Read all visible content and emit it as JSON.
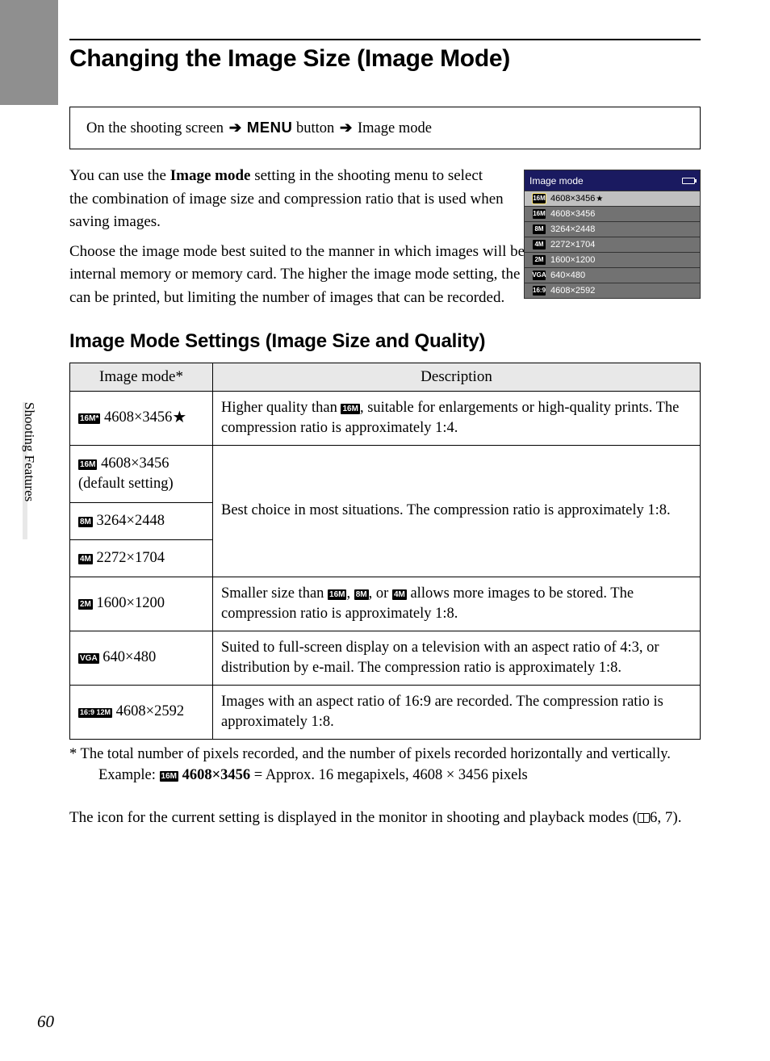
{
  "title": "Changing the Image Size (Image Mode)",
  "breadcrumb": {
    "pre": "On the shooting screen",
    "menu": "MENU",
    "mid": "button",
    "post": "Image mode"
  },
  "intro": {
    "p1_a": "You can use the ",
    "p1_bold": "Image mode",
    "p1_b": " setting in the shooting menu to select the combination of image size and compression ratio that is used when saving images.",
    "p2": "Choose the image mode best suited to the manner in which images will be used and the capacity of the internal memory or memory card. The higher the image mode setting, the larger the size at which it can be printed, but limiting the number of images that can be recorded."
  },
  "screenshot": {
    "title": "Image mode",
    "rows": [
      {
        "icon": "16M*",
        "label": "4608×3456",
        "star": true,
        "selected": true
      },
      {
        "icon": "16M",
        "label": "4608×3456"
      },
      {
        "icon": "8M",
        "label": "3264×2448"
      },
      {
        "icon": "4M",
        "label": "2272×1704"
      },
      {
        "icon": "2M",
        "label": "1600×1200"
      },
      {
        "icon": "VGA",
        "label": "640×480"
      },
      {
        "icon": "16:9",
        "label": "4608×2592"
      }
    ]
  },
  "subheading": "Image Mode Settings (Image Size and Quality)",
  "table": {
    "head_mode": "Image mode*",
    "head_desc": "Description",
    "r1_mode_icon": "16M*",
    "r1_mode_txt": "4608×3456",
    "r1_star": "★",
    "r1_desc_a": "Higher quality than ",
    "r1_desc_ic": "16M",
    "r1_desc_b": ", suitable for enlargements or high-quality prints. The compression ratio is approximately 1:4.",
    "r2_mode_icon": "16M",
    "r2_mode_txt": "4608×3456",
    "r2_sub": "(default setting)",
    "r3_mode_icon": "8M",
    "r3_mode_txt": "3264×2448",
    "r4_mode_icon": "4M",
    "r4_mode_txt": "2272×1704",
    "r234_desc": "Best choice in most situations. The compression ratio is approximately 1:8.",
    "r5_mode_icon": "2M",
    "r5_mode_txt": "1600×1200",
    "r5_desc_a": "Smaller size than ",
    "r5_ic1": "16M",
    "r5_sep1": ", ",
    "r5_ic2": "8M",
    "r5_sep2": ", or ",
    "r5_ic3": "4M",
    "r5_desc_b": " allows more images to be stored. The compression ratio is approximately 1:8.",
    "r6_mode_icon": "VGA",
    "r6_mode_txt": "640×480",
    "r6_desc": "Suited to full-screen display on a television with an aspect ratio of 4:3, or distribution by e-mail. The compression ratio is approximately 1:8.",
    "r7_mode_icon": "16:9 12M",
    "r7_mode_txt": "4608×2592",
    "r7_desc": "Images with an aspect ratio of 16:9 are recorded. The compression ratio is approximately 1:8."
  },
  "footnote": {
    "main": "*  The total number of pixels recorded, and the number of pixels recorded horizontally and vertically.",
    "ex_a": "Example: ",
    "ex_ic": "16M",
    "ex_bold": "4608×3456",
    "ex_b": " = Approx. 16 megapixels, 4608 × 3456 pixels"
  },
  "closing": {
    "a": "The icon for the current setting is displayed in the monitor in shooting and playback modes (",
    "b": "6, 7)."
  },
  "sidebar": "Shooting Features",
  "page_number": "60"
}
